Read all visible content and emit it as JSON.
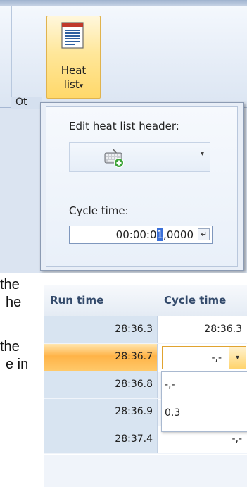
{
  "ribbon": {
    "group_label": "Ot",
    "heat_button": {
      "line1": "Heat",
      "line2": "list",
      "arrow": "▾",
      "icon": "document-list-icon"
    }
  },
  "panel": {
    "header_label": "Edit heat list header:",
    "header_combo_icon": "keyboard-add-icon",
    "header_combo_arrow": "▾",
    "cycle_label": "Cycle time:",
    "cycle_value_before": "00:00:0",
    "cycle_value_selected": "1",
    "cycle_value_after": ",0000",
    "enter_icon": "↵"
  },
  "fragments": {
    "line1": "the",
    "line2": "he",
    "line3": "the",
    "line4": "e in"
  },
  "grid": {
    "columns": [
      "Run time",
      "Cycle time"
    ],
    "rows": [
      {
        "run": "28:36.3",
        "cycle": "28:36.3"
      },
      {
        "run": "28:36.7",
        "cycle": "-,-",
        "active": true
      },
      {
        "run": "28:36.8",
        "cycle": ""
      },
      {
        "run": "28:36.9",
        "cycle": ""
      },
      {
        "run": "28:37.4",
        "cycle": "-,-"
      }
    ],
    "dropdown_arrow": "▾",
    "dropdown_options": [
      "-,-",
      "0.3"
    ]
  },
  "colors": {
    "ribbon_highlight": "#ffd86a",
    "active_row": "#ffb347",
    "selection": "#3a6fd8"
  }
}
